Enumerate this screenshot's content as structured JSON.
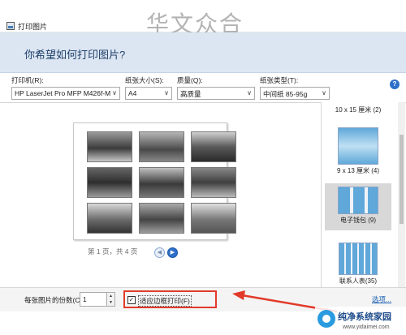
{
  "window": {
    "title": "打印图片",
    "watermark": "华文众合"
  },
  "header": {
    "prompt": "你希望如何打印图片?"
  },
  "settings": {
    "printer": {
      "label": "打印机(R):",
      "value": "HP LaserJet Pro MFP M426f-M"
    },
    "paper_size": {
      "label": "纸张大小(S):",
      "value": "A4"
    },
    "quality": {
      "label": "质量(Q):",
      "value": "高质量"
    },
    "paper_type": {
      "label": "纸张类型(T):",
      "value": "中间纸 85-95g"
    },
    "help": "?"
  },
  "preview": {
    "pager_text": "第 1 页，共 4 页",
    "prev": "◀",
    "next": "▶"
  },
  "layouts": {
    "items": [
      {
        "label": "10 x 15 厘米 (2)"
      },
      {
        "label": "9 x 13 厘米 (4)"
      },
      {
        "label": "电子钱包 (9)",
        "selected": true
      },
      {
        "label": "联系人表(35)"
      }
    ]
  },
  "bottom": {
    "copies_label": "每张图片的份数(C):",
    "copies_value": "1",
    "spin_up": "▲",
    "spin_down": "▼",
    "fit_label": "适应边框打印(F)",
    "fit_checked": "✓",
    "options_link": "选项..."
  },
  "badge": {
    "brand": "纯净系统家园",
    "domain": "www.yidaimei.com"
  },
  "colors": {
    "accent": "#2e6fc9",
    "header_bg": "#dce6f2",
    "highlight": "#e23a2a"
  }
}
